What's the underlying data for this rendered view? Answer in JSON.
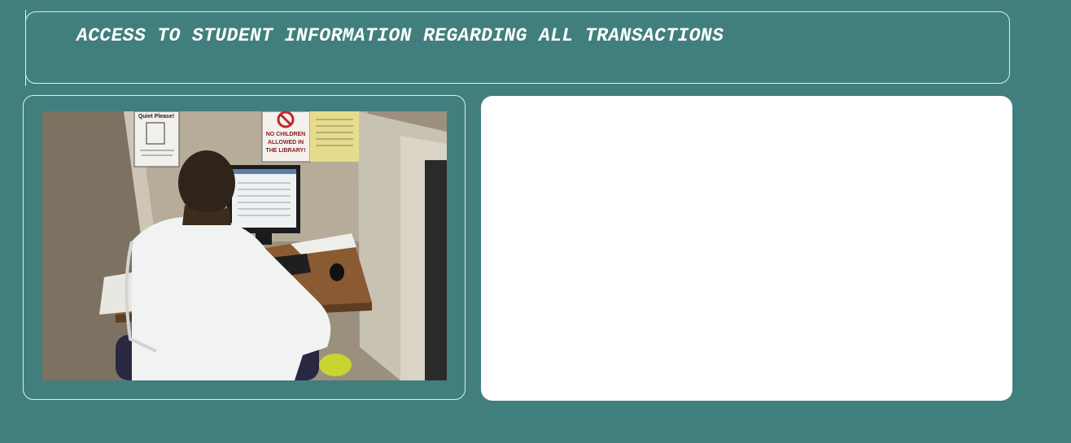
{
  "header": {
    "title": "ACCESS TO STUDENT INFORMATION REGARDING ALL TRANSACTIONS"
  },
  "photo": {
    "sign_quiet": "Quiet Please!",
    "sign_children_1": "NO CHILDREN",
    "sign_children_2": "ALLOWED IN",
    "sign_children_3": "THE LIBRARY!"
  },
  "content_panel": {}
}
